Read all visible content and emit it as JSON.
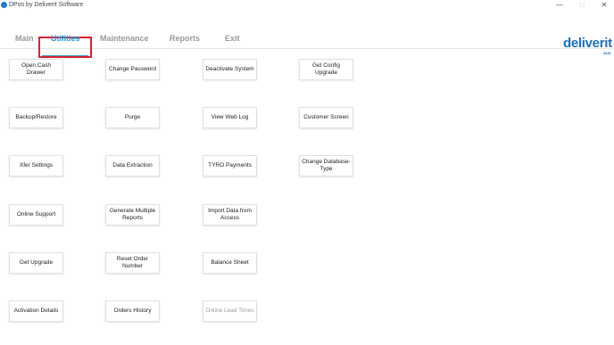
{
  "window": {
    "title": "DPos by Deliverit Software",
    "minimize_glyph": "—",
    "maximize_glyph": "□",
    "close_glyph": "✕"
  },
  "menu": {
    "tabs": [
      {
        "label": "Main"
      },
      {
        "label": "Utilities",
        "active": true
      },
      {
        "label": "Maintenance"
      },
      {
        "label": "Reports"
      },
      {
        "label": "Exit"
      }
    ]
  },
  "logo": {
    "text": "deliverit",
    "subtext": "AUS"
  },
  "colors": {
    "accent": "#2a96d8",
    "highlight_frame": "#d9232d",
    "logo": "#1b6fbf",
    "disabled_text": "#9a9a9a"
  },
  "buttons": [
    {
      "label": "Open Cash Drawer"
    },
    {
      "label": "Change Password"
    },
    {
      "label": "Deactivate System"
    },
    {
      "label": "Get Config Upgrade"
    },
    {
      "label": "Backup/Restore"
    },
    {
      "label": "Purge"
    },
    {
      "label": "View Web Log"
    },
    {
      "label": "Customer Screen"
    },
    {
      "label": "Xfer Settings"
    },
    {
      "label": "Data Extraction"
    },
    {
      "label": "TYRO Payments"
    },
    {
      "label": "Change Database-Type"
    },
    {
      "label": "Online Support"
    },
    {
      "label": "Generate Multiple Reports"
    },
    {
      "label": "Import Data from Access"
    },
    {
      "label": "Get Upgrade"
    },
    {
      "label": "Reset Order Number"
    },
    {
      "label": "Balance Sheet"
    },
    {
      "label": "Activation Details"
    },
    {
      "label": "Orders History"
    },
    {
      "label": "Online Lead Times",
      "enabled": false
    }
  ]
}
